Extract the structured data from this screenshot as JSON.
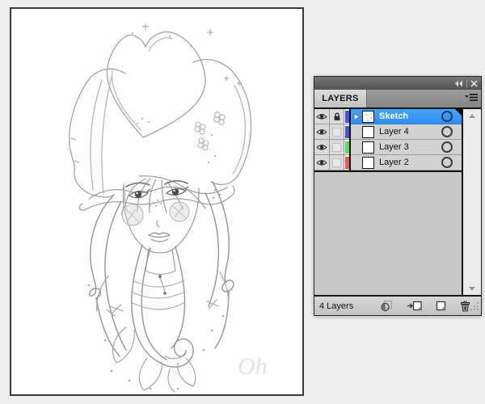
{
  "canvas": {
    "signature": "Oh",
    "description": "pencil sketch of a girl wearing a large heart-shaped bow hat"
  },
  "panel": {
    "tab": "LAYERS",
    "titlebar": {
      "collapse_label": "Collapse to Icons",
      "close_label": "Close"
    },
    "menu_label": "Panel menu",
    "layers": [
      {
        "name": "Sketch",
        "color": "#4a50e0",
        "visible": true,
        "locked": true,
        "selected": true
      },
      {
        "name": "Layer 4",
        "color": "#4a50e0",
        "visible": true,
        "locked": false,
        "selected": false
      },
      {
        "name": "Layer 3",
        "color": "#4ae84a",
        "visible": true,
        "locked": false,
        "selected": false
      },
      {
        "name": "Layer 2",
        "color": "#f2564f",
        "visible": true,
        "locked": false,
        "selected": false
      }
    ],
    "status_text": "4 Layers",
    "toolbar": {
      "clipping_mask_label": "Make/Release Clipping Mask",
      "new_sublayer_label": "Create New Sublayer",
      "new_layer_label": "Create New Layer",
      "delete_label": "Delete Selection"
    }
  }
}
